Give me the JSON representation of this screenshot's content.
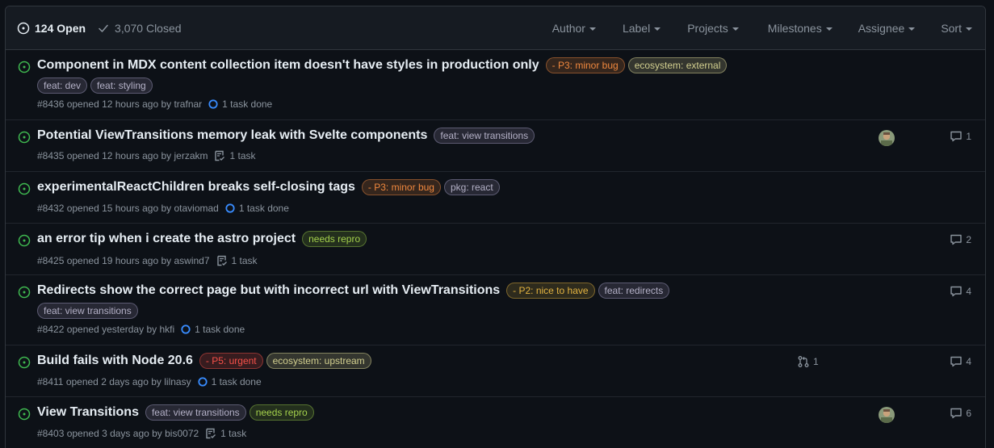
{
  "header": {
    "open_label": "124 Open",
    "closed_label": "3,070 Closed",
    "filters": [
      "Author",
      "Label",
      "Projects",
      "Milestones",
      "Assignee",
      "Sort"
    ]
  },
  "colors": {
    "open_icon": "#3fb950",
    "p3": "#f0883e",
    "p2": "#e3b341",
    "p5": "#f85149",
    "ecosystem": "#d2cf8f",
    "feat": "#b3b0c6",
    "needs_repro": "#a4d14c",
    "task": "#388bfd"
  },
  "issues": [
    {
      "title": "Component in MDX content collection item doesn't have styles in production only",
      "labels": [
        "- P3: minor bug",
        "ecosystem: external"
      ],
      "labels_line2": [
        "feat: dev",
        "feat: styling"
      ],
      "meta": "#8436 opened 12 hours ago by trafnar",
      "task": "1 task done"
    },
    {
      "title": "Potential ViewTransitions memory leak with Svelte components",
      "labels": [
        "feat: view transitions"
      ],
      "meta": "#8435 opened 12 hours ago by jerzakm",
      "task": "1 task",
      "comments": "1"
    },
    {
      "title": "experimentalReactChildren breaks self-closing tags",
      "labels": [
        "- P3: minor bug",
        "pkg: react"
      ],
      "meta": "#8432 opened 15 hours ago by otaviomad",
      "task": "1 task done"
    },
    {
      "title": "an error tip when i create the astro project",
      "labels": [
        "needs repro"
      ],
      "meta": "#8425 opened 19 hours ago by aswind7",
      "task": "1 task",
      "comments": "2"
    },
    {
      "title": "Redirects show the correct page but with incorrect url with ViewTransitions",
      "labels": [
        "- P2: nice to have",
        "feat: redirects"
      ],
      "labels_line2": [
        "feat: view transitions"
      ],
      "meta": "#8422 opened yesterday by hkfi",
      "task": "1 task done",
      "comments": "4"
    },
    {
      "title": "Build fails with Node 20.6",
      "labels": [
        "- P5: urgent",
        "ecosystem: upstream"
      ],
      "meta": "#8411 opened 2 days ago by lilnasy",
      "task": "1 task done",
      "pull_requests": "1",
      "comments": "4"
    },
    {
      "title": "View Transitions",
      "labels": [
        "feat: view transitions",
        "needs repro"
      ],
      "meta": "#8403 opened 3 days ago by bis0072",
      "task": "1 task",
      "comments": "6"
    }
  ]
}
